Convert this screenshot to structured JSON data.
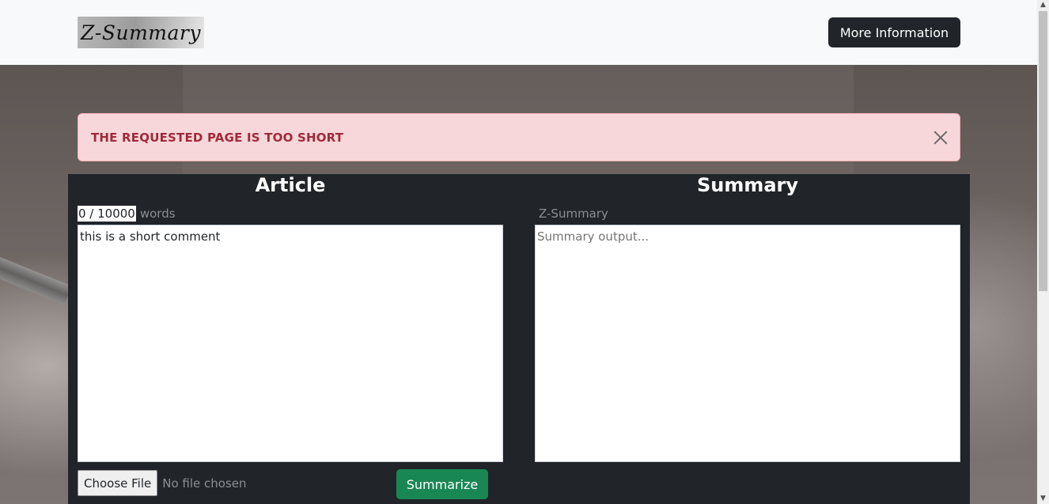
{
  "navbar": {
    "logo_text": "Z-Summary",
    "more_button": "More Information"
  },
  "alert": {
    "message": "THE REQUESTED PAGE IS TOO SHORT"
  },
  "article": {
    "heading": "Article",
    "word_count": "0 / 10000",
    "word_unit": "words",
    "text": "this is a short comment",
    "file_button": "Choose File",
    "file_status": "No file chosen",
    "summarize_button": "Summarize"
  },
  "summary": {
    "heading": "Summary",
    "label": "Z-Summary",
    "placeholder": "Summary output..."
  },
  "colors": {
    "navbar_bg": "#f8f9fa",
    "dark": "#212529",
    "alert_bg": "#f8d7da",
    "alert_text": "#9e2a3a",
    "success": "#198754"
  }
}
